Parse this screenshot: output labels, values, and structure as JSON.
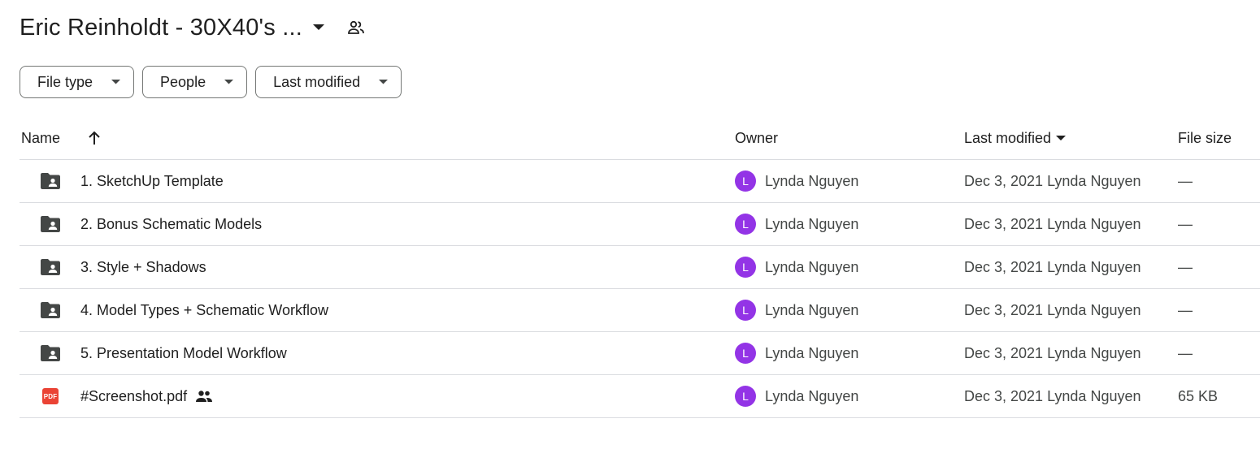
{
  "header": {
    "folder_title": "Eric Reinholdt - 30X40's ...",
    "caret_icon": "arrow-drop-down-icon",
    "shared_icon": "shared-people-icon"
  },
  "filters": [
    {
      "label": "File type",
      "icon": "arrow-drop-down-icon"
    },
    {
      "label": "People",
      "icon": "arrow-drop-down-icon"
    },
    {
      "label": "Last modified",
      "icon": "arrow-drop-down-icon"
    }
  ],
  "table": {
    "columns": {
      "name": "Name",
      "owner": "Owner",
      "last_modified": "Last modified",
      "file_size": "File size"
    },
    "sort_icon": "arrow-upward-icon",
    "rows": [
      {
        "icon": "shared-folder-icon",
        "name": "1. SketchUp Template",
        "shared": false,
        "owner_initial": "L",
        "owner": "Lynda Nguyen",
        "modified": "Dec 3, 2021 Lynda Nguyen",
        "size": "—"
      },
      {
        "icon": "shared-folder-icon",
        "name": "2. Bonus Schematic Models",
        "shared": false,
        "owner_initial": "L",
        "owner": "Lynda Nguyen",
        "modified": "Dec 3, 2021 Lynda Nguyen",
        "size": "—"
      },
      {
        "icon": "shared-folder-icon",
        "name": "3. Style + Shadows",
        "shared": false,
        "owner_initial": "L",
        "owner": "Lynda Nguyen",
        "modified": "Dec 3, 2021 Lynda Nguyen",
        "size": "—"
      },
      {
        "icon": "shared-folder-icon",
        "name": "4. Model Types + Schematic Workflow",
        "shared": false,
        "owner_initial": "L",
        "owner": "Lynda Nguyen",
        "modified": "Dec 3, 2021 Lynda Nguyen",
        "size": "—"
      },
      {
        "icon": "shared-folder-icon",
        "name": "5. Presentation Model Workflow",
        "shared": false,
        "owner_initial": "L",
        "owner": "Lynda Nguyen",
        "modified": "Dec 3, 2021 Lynda Nguyen",
        "size": "—"
      },
      {
        "icon": "pdf-icon",
        "icon_text": "PDF",
        "name": "#Screenshot.pdf",
        "shared": true,
        "owner_initial": "L",
        "owner": "Lynda Nguyen",
        "modified": "Dec 3, 2021 Lynda Nguyen",
        "size": "65 KB"
      }
    ]
  },
  "colors": {
    "avatar": "#9334e6",
    "folder_icon": "#444746",
    "pdf_red": "#ea4335",
    "divider": "#dadce0"
  }
}
